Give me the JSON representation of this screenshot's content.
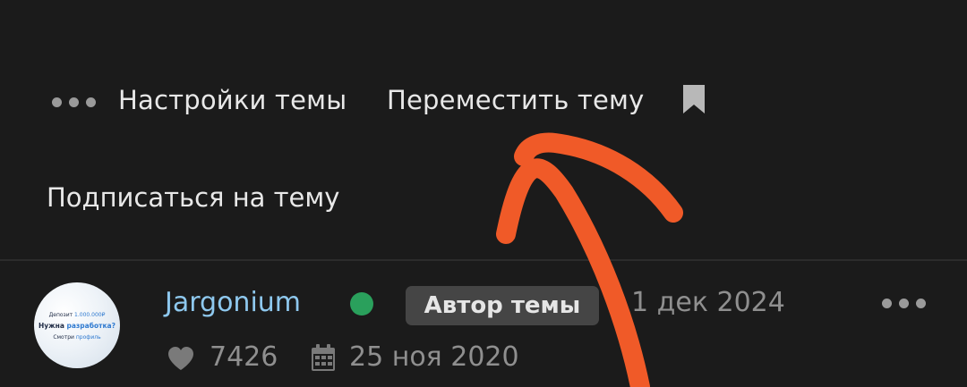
{
  "topic_actions": {
    "more_icon": "ellipsis-icon",
    "settings_label": "Настройки темы",
    "move_label": "Переместить тему",
    "bookmark_icon": "bookmark-icon",
    "subscribe_label": "Подписаться на тему"
  },
  "post": {
    "avatar": {
      "line1_prefix": "Депозит ",
      "line1_amount": "1.000.000₽",
      "line2_prefix": "Нужна ",
      "line2_accent": "разработка?",
      "line3_prefix": "Смотри ",
      "line3_accent": "профиль"
    },
    "username": "Jargonium",
    "online_color": "#2aa05c",
    "author_badge": "Автор темы",
    "date": "1 дек 2024",
    "more_icon": "ellipsis-icon",
    "likes_icon": "heart-icon",
    "likes": "7426",
    "joined_icon": "calendar-icon",
    "joined": "25 ноя 2020"
  },
  "colors": {
    "background": "#1b1b1b",
    "username": "#8ec8ee",
    "badge_bg": "#454545",
    "annotation_arrow": "#f05a28"
  }
}
